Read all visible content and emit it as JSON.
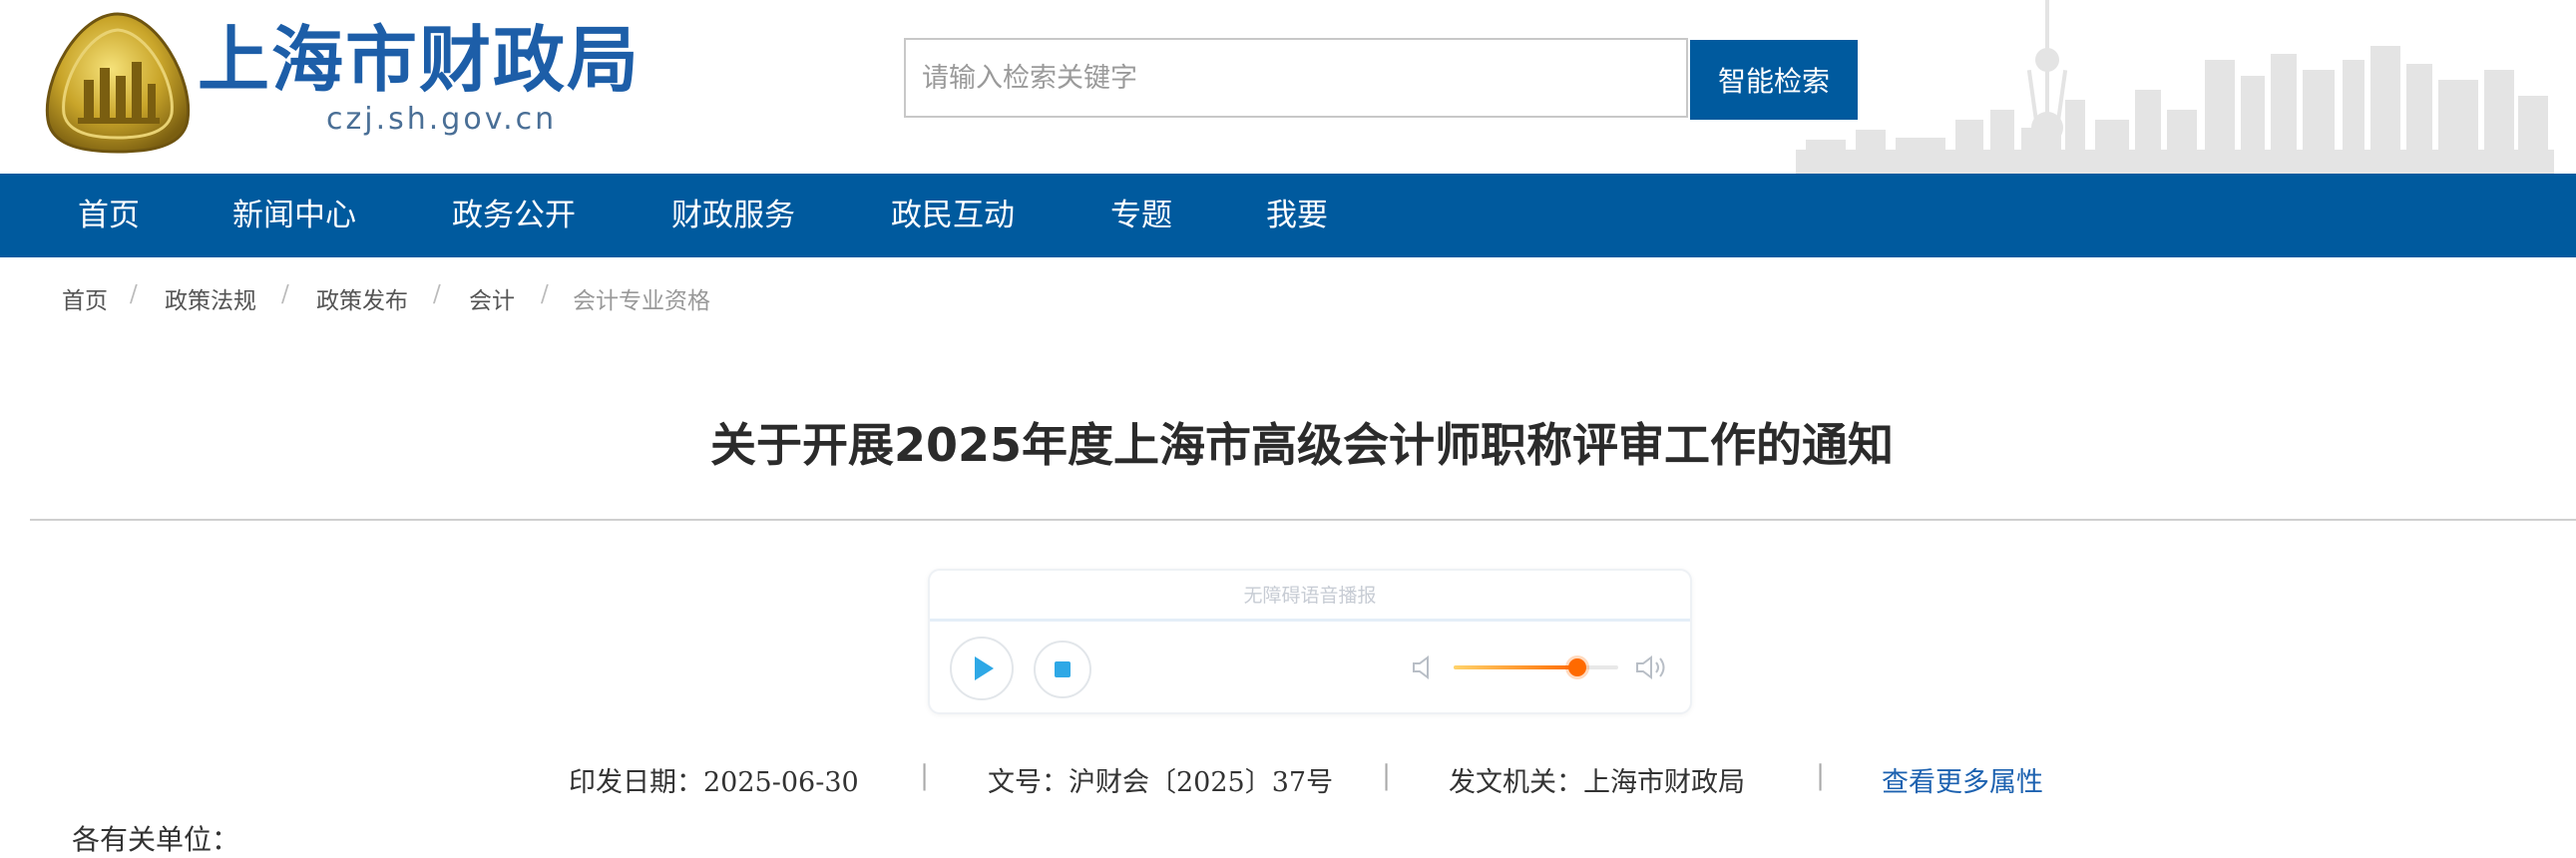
{
  "header": {
    "site_name": "上海市财政局",
    "site_domain": "czj.sh.gov.cn",
    "search_placeholder": "请输入检索关键字",
    "search_button": "智能检索"
  },
  "nav": {
    "items": [
      "首页",
      "新闻中心",
      "政务公开",
      "财政服务",
      "政民互动",
      "专题",
      "我要"
    ]
  },
  "breadcrumb": {
    "items": [
      "首页",
      "政策法规",
      "政策发布",
      "会计",
      "会计专业资格"
    ],
    "separator": "/"
  },
  "article": {
    "title": "关于开展2025年度上海市高级会计师职称评审工作的通知",
    "first_line": "各有关单位："
  },
  "player": {
    "title": "无障碍语音播报",
    "volume": 0.75
  },
  "meta": {
    "date": "印发日期：2025-06-30",
    "doc_no": "文号：沪财会〔2025〕37号",
    "issuer": "发文机关：上海市财政局",
    "more_link": "查看更多属性",
    "separator": "|"
  },
  "colors": {
    "brand_blue": "#005a9e",
    "link_blue": "#1d62b0",
    "play_icon": "#2ea8e6",
    "volume_accent": "#ff6a00"
  }
}
